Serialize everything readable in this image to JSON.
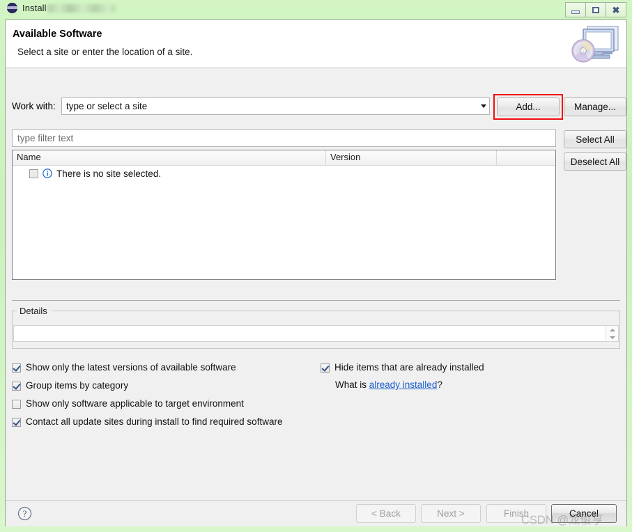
{
  "window": {
    "title": "Install",
    "icon": "eclipse-icon",
    "controls": {
      "minimize": "Minimize",
      "maximize": "Maximize",
      "close": "Close"
    }
  },
  "header": {
    "title": "Available Software",
    "subtitle": "Select a site or enter the location of a site.",
    "icon": "monitor-disc-icon"
  },
  "work_with": {
    "label": "Work with:",
    "value": "",
    "placeholder": "type or select a site",
    "add_label": "Add...",
    "manage_label": "Manage..."
  },
  "filter": {
    "value": "",
    "placeholder": "type filter text"
  },
  "list_actions": {
    "select_all": "Select All",
    "deselect_all": "Deselect All"
  },
  "table": {
    "columns": [
      "Name",
      "Version",
      ""
    ],
    "rows": [
      {
        "name": "There is no site selected.",
        "version": "",
        "checked": false,
        "icon": "info-icon"
      }
    ]
  },
  "details": {
    "legend": "Details",
    "text": ""
  },
  "options": {
    "left": [
      {
        "label": "Show only the latest versions of available software",
        "checked": true
      },
      {
        "label": "Group items by category",
        "checked": true
      },
      {
        "label": "Show only software applicable to target environment",
        "checked": false
      },
      {
        "label": "Contact all update sites during install to find required software",
        "checked": true
      }
    ],
    "right": [
      {
        "label": "Hide items that are already installed",
        "checked": true
      }
    ],
    "whatis_prefix": "What is ",
    "whatis_link": "already installed",
    "whatis_suffix": "?"
  },
  "footer": {
    "help": "?",
    "back": "< Back",
    "next": "Next >",
    "finish": "Finish",
    "cancel": "Cancel"
  },
  "watermark": "CSDN @龙俊亨",
  "colors": {
    "titlebar": "#caf2ba",
    "dialog_bg": "#f0f0f0",
    "highlight": "#f40c0c",
    "link": "#1a5fd0"
  }
}
